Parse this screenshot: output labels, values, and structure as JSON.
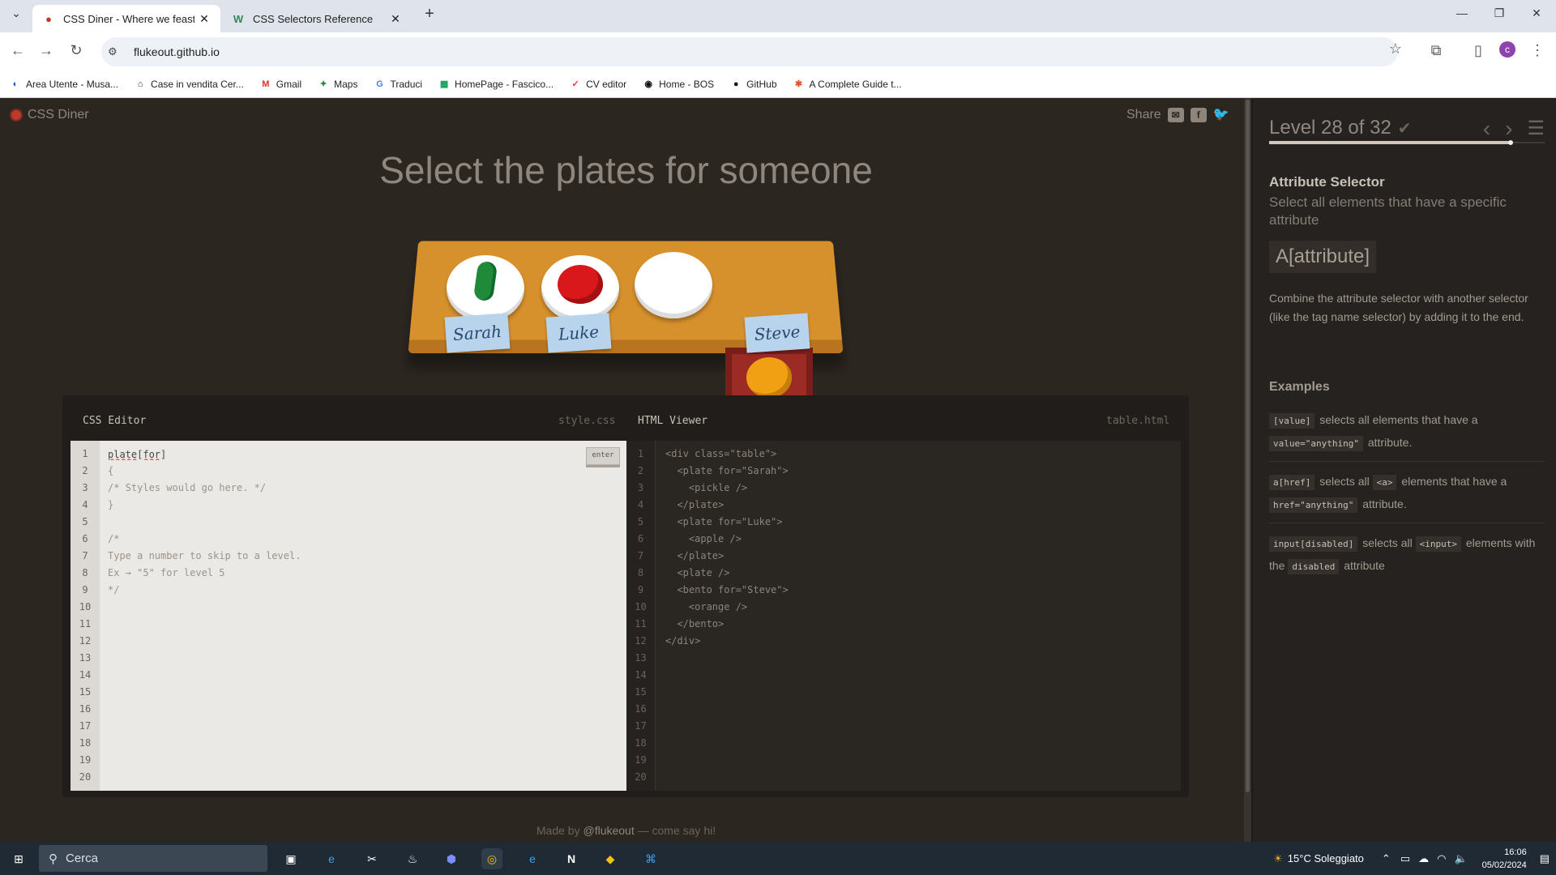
{
  "browser": {
    "tabs": [
      {
        "title": "CSS Diner - Where we feast on",
        "icon": "red-dot-icon"
      },
      {
        "title": "CSS Selectors Reference",
        "icon": "w3-icon"
      }
    ],
    "url": "flukeout.github.io",
    "bookmarks": [
      "Area Utente - Musa...",
      "Case in vendita Cer...",
      "Gmail",
      "Maps",
      "Traduci",
      "HomePage - Fascico...",
      "CV editor",
      "Home - BOS",
      "GitHub",
      "A Complete Guide t..."
    ]
  },
  "header": {
    "logo": "CSS Diner",
    "share": "Share"
  },
  "instruction": "Select the plates for someone",
  "table": {
    "names": [
      "Sarah",
      "Luke",
      "Steve"
    ]
  },
  "editor": {
    "css_title": "CSS Editor",
    "css_file": "style.css",
    "html_title": "HTML Viewer",
    "html_file": "table.html",
    "input_value": "plate[for]",
    "enter_label": "enter",
    "css_lines": "{\n/* Styles would go here. */\n}\n\n/*\nType a number to skip to a level.\nEx → \"5\" for level 5\n*/",
    "html_lines": "<div class=\"table\">\n  <plate for=\"Sarah\">\n    <pickle />\n  </plate>\n  <plate for=\"Luke\">\n    <apple />\n  </plate>\n  <plate />\n  <bento for=\"Steve\">\n    <orange />\n  </bento>\n</div>",
    "line_numbers": "1\n2\n3\n4\n5\n6\n7\n8\n9\n10\n11\n12\n13\n14\n15\n16\n17\n18\n19\n20"
  },
  "footer": {
    "prefix": "Made by ",
    "author": "@flukeout",
    "suffix": " — come say hi!"
  },
  "sidebar": {
    "level": "Level 28 of 32",
    "progress": 0.875,
    "selector_name": "Attribute Selector",
    "selector_title": "Select all elements that have a specific attribute",
    "syntax": "A[attribute]",
    "hint": "Combine the attribute selector with another selector (like the tag name selector) by adding it to the end.",
    "examples_title": "Examples",
    "examples": [
      {
        "c1": "[value]",
        "t1": " selects all elements that have a ",
        "c2": "value=\"anything\"",
        "t2": " attribute."
      },
      {
        "c1": "a[href]",
        "t1": " selects all ",
        "c2": "<a>",
        "t2": " elements that have a ",
        "c3": "href=\"anything\"",
        "t3": " attribute."
      },
      {
        "c1": "input[disabled]",
        "t1": " selects all ",
        "c2": "<input>",
        "t2": " elements with the ",
        "c3": "disabled",
        "t3": " attribute"
      }
    ]
  },
  "taskbar": {
    "search": "Cerca",
    "weather": "15°C Soleggiato",
    "time": "16:06",
    "date": "05/02/2024"
  }
}
